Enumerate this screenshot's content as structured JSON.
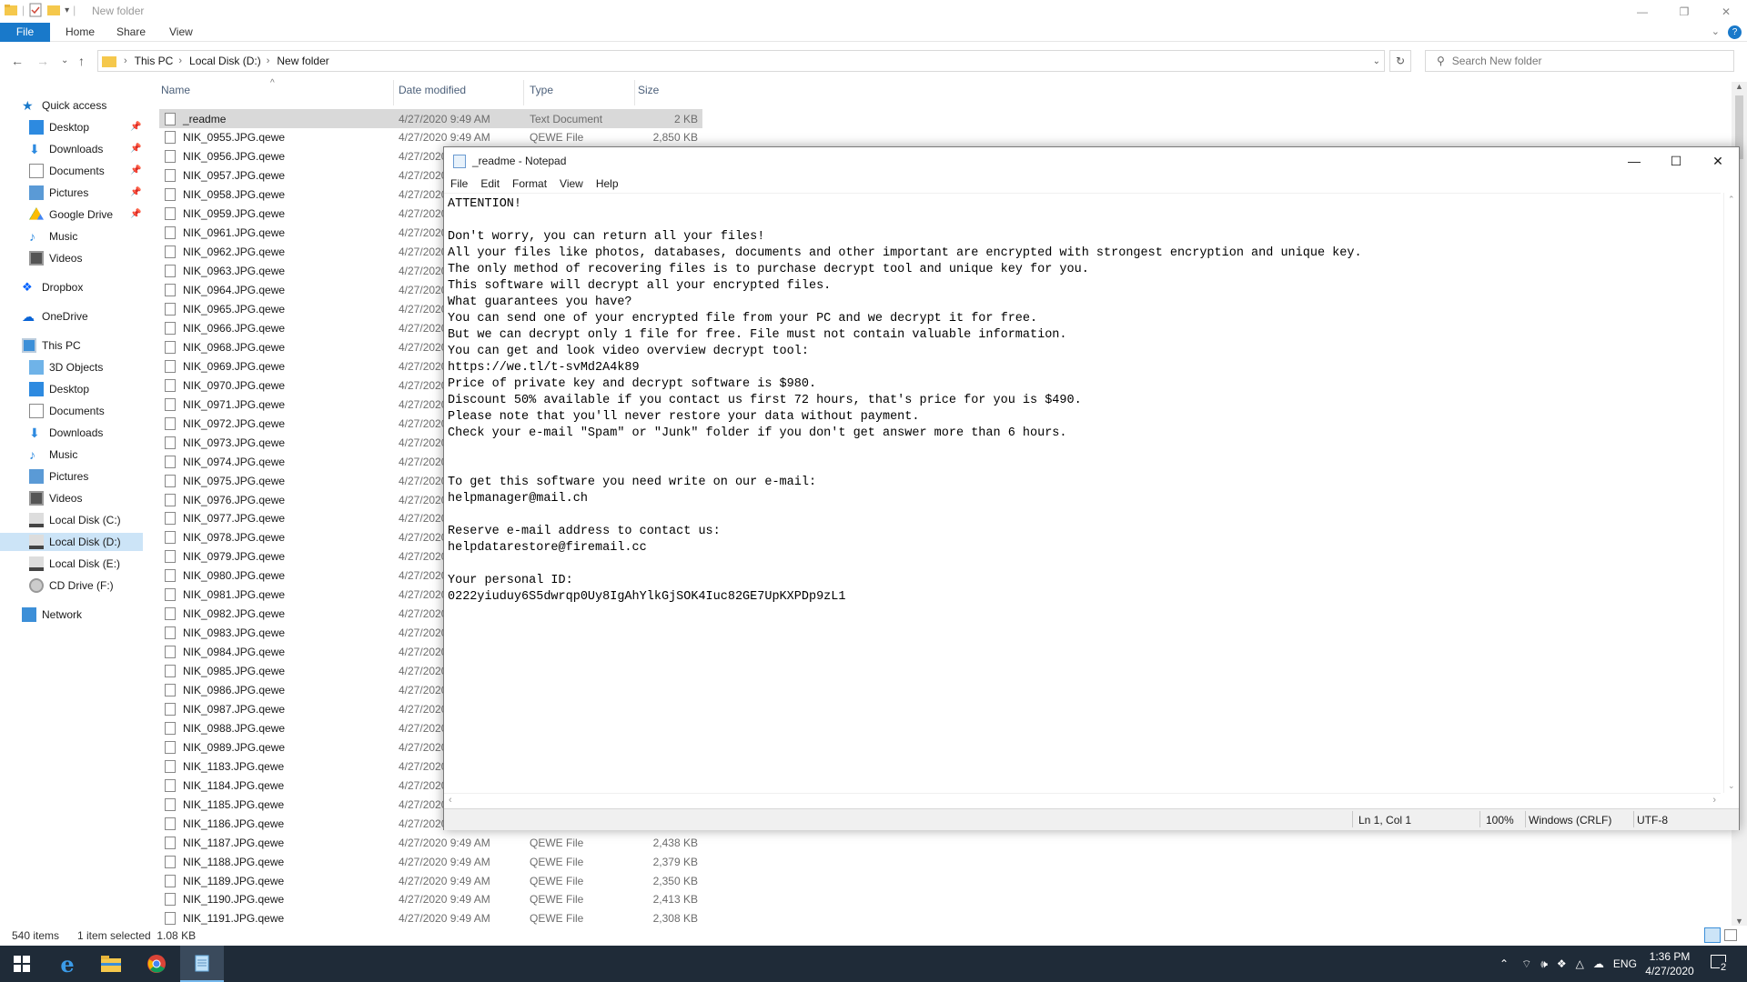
{
  "explorer": {
    "title": "New folder",
    "ribbon_tabs": [
      "File",
      "Home",
      "Share",
      "View"
    ],
    "breadcrumb": [
      "This PC",
      "Local Disk (D:)",
      "New folder"
    ],
    "search_placeholder": "Search New folder",
    "columns": {
      "name": "Name",
      "date": "Date modified",
      "type": "Type",
      "size": "Size"
    },
    "nav": {
      "quick_access": "Quick access",
      "quick_items": [
        "Desktop",
        "Downloads",
        "Documents",
        "Pictures",
        "Google Drive",
        "Music",
        "Videos"
      ],
      "dropbox": "Dropbox",
      "onedrive": "OneDrive",
      "this_pc": "This PC",
      "pc_items": [
        "3D Objects",
        "Desktop",
        "Documents",
        "Downloads",
        "Music",
        "Pictures",
        "Videos",
        "Local Disk (C:)",
        "Local Disk (D:)",
        "Local Disk (E:)",
        "CD Drive (F:)"
      ],
      "network": "Network"
    },
    "files": [
      {
        "name": "_readme",
        "date": "4/27/2020 9:49 AM",
        "type": "Text Document",
        "size": "2 KB"
      },
      {
        "name": "NIK_0955.JPG.qewe",
        "date": "4/27/2020 9:49 AM",
        "type": "QEWE File",
        "size": "2,850 KB"
      },
      {
        "name": "NIK_0956.JPG.qewe",
        "date": "4/27/2020",
        "type": "",
        "size": ""
      },
      {
        "name": "NIK_0957.JPG.qewe",
        "date": "4/27/2020",
        "type": "",
        "size": ""
      },
      {
        "name": "NIK_0958.JPG.qewe",
        "date": "4/27/2020",
        "type": "",
        "size": ""
      },
      {
        "name": "NIK_0959.JPG.qewe",
        "date": "4/27/2020",
        "type": "",
        "size": ""
      },
      {
        "name": "NIK_0961.JPG.qewe",
        "date": "4/27/2020",
        "type": "",
        "size": ""
      },
      {
        "name": "NIK_0962.JPG.qewe",
        "date": "4/27/2020",
        "type": "",
        "size": ""
      },
      {
        "name": "NIK_0963.JPG.qewe",
        "date": "4/27/2020",
        "type": "",
        "size": ""
      },
      {
        "name": "NIK_0964.JPG.qewe",
        "date": "4/27/2020",
        "type": "",
        "size": ""
      },
      {
        "name": "NIK_0965.JPG.qewe",
        "date": "4/27/2020",
        "type": "",
        "size": ""
      },
      {
        "name": "NIK_0966.JPG.qewe",
        "date": "4/27/2020",
        "type": "",
        "size": ""
      },
      {
        "name": "NIK_0968.JPG.qewe",
        "date": "4/27/2020",
        "type": "",
        "size": ""
      },
      {
        "name": "NIK_0969.JPG.qewe",
        "date": "4/27/2020",
        "type": "",
        "size": ""
      },
      {
        "name": "NIK_0970.JPG.qewe",
        "date": "4/27/2020",
        "type": "",
        "size": ""
      },
      {
        "name": "NIK_0971.JPG.qewe",
        "date": "4/27/2020",
        "type": "",
        "size": ""
      },
      {
        "name": "NIK_0972.JPG.qewe",
        "date": "4/27/2020",
        "type": "",
        "size": ""
      },
      {
        "name": "NIK_0973.JPG.qewe",
        "date": "4/27/2020",
        "type": "",
        "size": ""
      },
      {
        "name": "NIK_0974.JPG.qewe",
        "date": "4/27/2020",
        "type": "",
        "size": ""
      },
      {
        "name": "NIK_0975.JPG.qewe",
        "date": "4/27/2020",
        "type": "",
        "size": ""
      },
      {
        "name": "NIK_0976.JPG.qewe",
        "date": "4/27/2020",
        "type": "",
        "size": ""
      },
      {
        "name": "NIK_0977.JPG.qewe",
        "date": "4/27/2020",
        "type": "",
        "size": ""
      },
      {
        "name": "NIK_0978.JPG.qewe",
        "date": "4/27/2020",
        "type": "",
        "size": ""
      },
      {
        "name": "NIK_0979.JPG.qewe",
        "date": "4/27/2020",
        "type": "",
        "size": ""
      },
      {
        "name": "NIK_0980.JPG.qewe",
        "date": "4/27/2020",
        "type": "",
        "size": ""
      },
      {
        "name": "NIK_0981.JPG.qewe",
        "date": "4/27/2020",
        "type": "",
        "size": ""
      },
      {
        "name": "NIK_0982.JPG.qewe",
        "date": "4/27/2020",
        "type": "",
        "size": ""
      },
      {
        "name": "NIK_0983.JPG.qewe",
        "date": "4/27/2020",
        "type": "",
        "size": ""
      },
      {
        "name": "NIK_0984.JPG.qewe",
        "date": "4/27/2020",
        "type": "",
        "size": ""
      },
      {
        "name": "NIK_0985.JPG.qewe",
        "date": "4/27/2020",
        "type": "",
        "size": ""
      },
      {
        "name": "NIK_0986.JPG.qewe",
        "date": "4/27/2020",
        "type": "",
        "size": ""
      },
      {
        "name": "NIK_0987.JPG.qewe",
        "date": "4/27/2020",
        "type": "",
        "size": ""
      },
      {
        "name": "NIK_0988.JPG.qewe",
        "date": "4/27/2020",
        "type": "",
        "size": ""
      },
      {
        "name": "NIK_0989.JPG.qewe",
        "date": "4/27/2020",
        "type": "",
        "size": ""
      },
      {
        "name": "NIK_1183.JPG.qewe",
        "date": "4/27/2020",
        "type": "",
        "size": ""
      },
      {
        "name": "NIK_1184.JPG.qewe",
        "date": "4/27/2020",
        "type": "",
        "size": ""
      },
      {
        "name": "NIK_1185.JPG.qewe",
        "date": "4/27/2020",
        "type": "",
        "size": ""
      },
      {
        "name": "NIK_1186.JPG.qewe",
        "date": "4/27/2020",
        "type": "",
        "size": ""
      },
      {
        "name": "NIK_1187.JPG.qewe",
        "date": "4/27/2020 9:49 AM",
        "type": "QEWE File",
        "size": "2,438 KB"
      },
      {
        "name": "NIK_1188.JPG.qewe",
        "date": "4/27/2020 9:49 AM",
        "type": "QEWE File",
        "size": "2,379 KB"
      },
      {
        "name": "NIK_1189.JPG.qewe",
        "date": "4/27/2020 9:49 AM",
        "type": "QEWE File",
        "size": "2,350 KB"
      },
      {
        "name": "NIK_1190.JPG.qewe",
        "date": "4/27/2020 9:49 AM",
        "type": "QEWE File",
        "size": "2,413 KB"
      },
      {
        "name": "NIK_1191.JPG.qewe",
        "date": "4/27/2020 9:49 AM",
        "type": "QEWE File",
        "size": "2,308 KB"
      }
    ],
    "status": {
      "items": "540 items",
      "selected": "1 item selected  1.08 KB"
    }
  },
  "notepad": {
    "title": "_readme - Notepad",
    "menu": [
      "File",
      "Edit",
      "Format",
      "View",
      "Help"
    ],
    "content": "ATTENTION!\n\nDon't worry, you can return all your files!\nAll your files like photos, databases, documents and other important are encrypted with strongest encryption and unique key.\nThe only method of recovering files is to purchase decrypt tool and unique key for you.\nThis software will decrypt all your encrypted files.\nWhat guarantees you have?\nYou can send one of your encrypted file from your PC and we decrypt it for free.\nBut we can decrypt only 1 file for free. File must not contain valuable information.\nYou can get and look video overview decrypt tool:\nhttps://we.tl/t-svMd2A4k89\nPrice of private key and decrypt software is $980.\nDiscount 50% available if you contact us first 72 hours, that's price for you is $490.\nPlease note that you'll never restore your data without payment.\nCheck your e-mail \"Spam\" or \"Junk\" folder if you don't get answer more than 6 hours.\n\n\nTo get this software you need write on our e-mail:\nhelpmanager@mail.ch\n\nReserve e-mail address to contact us:\nhelpdatarestore@firemail.cc\n\nYour personal ID:\n0222yiuduy6S5dwrqp0Uy8IgAhYlkGjSOK4Iuc82GE7UpKXPDp9zL1",
    "status": {
      "position": "Ln 1, Col 1",
      "zoom": "100%",
      "line_ending": "Windows (CRLF)",
      "encoding": "UTF-8"
    }
  },
  "taskbar": {
    "language": "ENG",
    "time": "1:36 PM",
    "date": "4/27/2020",
    "notification_count": "2"
  },
  "colors": {
    "accent": "#1979ca",
    "taskbar": "#1f2b38",
    "selection": "#cce4f7"
  }
}
